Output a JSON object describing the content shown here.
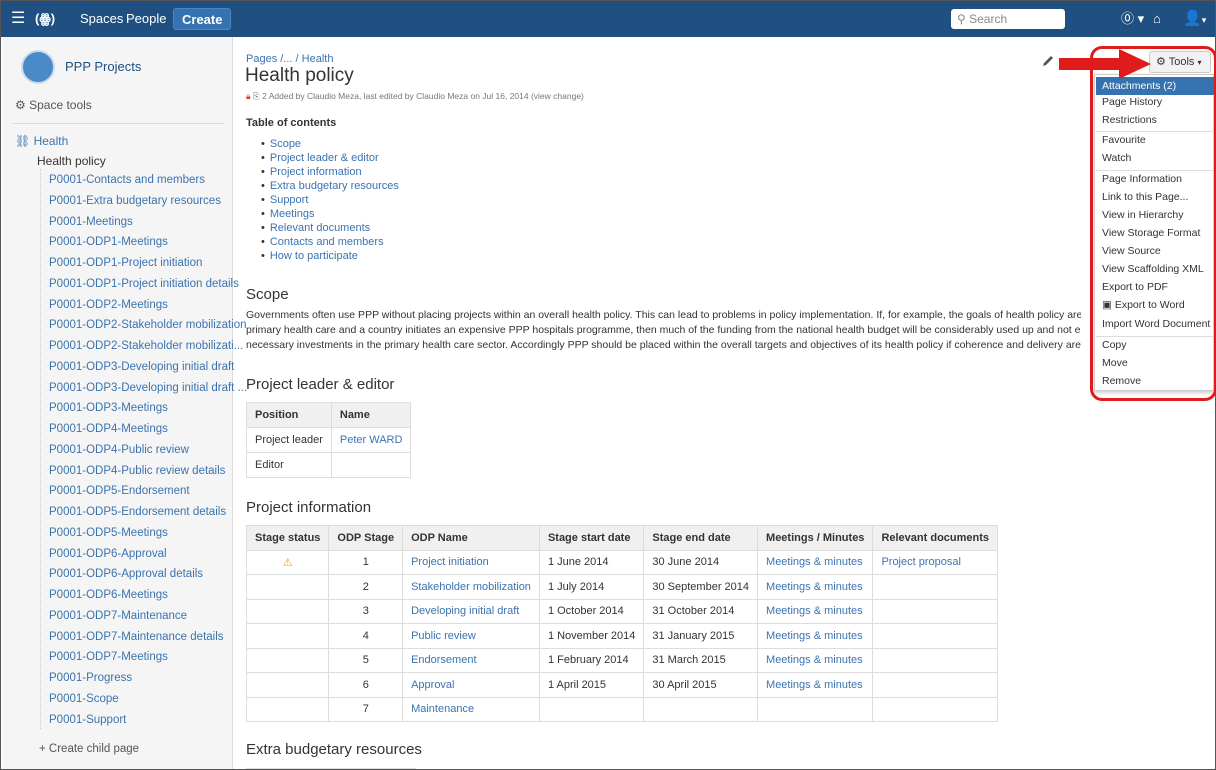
{
  "topbar": {
    "spaces": "Spaces",
    "people": "People",
    "create": "Create",
    "search_placeholder": "Search"
  },
  "sidebar": {
    "space_name": "PPP Projects",
    "space_tools": "Space tools",
    "tree_root": "Health",
    "current_page": "Health policy",
    "children": [
      "P0001-Contacts and members",
      "P0001-Extra budgetary resources",
      "P0001-Meetings",
      "P0001-ODP1-Meetings",
      "P0001-ODP1-Project initiation",
      "P0001-ODP1-Project initiation details",
      "P0001-ODP2-Meetings",
      "P0001-ODP2-Stakeholder mobilization",
      "P0001-ODP2-Stakeholder mobilizati...",
      "P0001-ODP3-Developing initial draft",
      "P0001-ODP3-Developing initial draft ...",
      "P0001-ODP3-Meetings",
      "P0001-ODP4-Meetings",
      "P0001-ODP4-Public review",
      "P0001-ODP4-Public review details",
      "P0001-ODP5-Endorsement",
      "P0001-ODP5-Endorsement details",
      "P0001-ODP5-Meetings",
      "P0001-ODP6-Approval",
      "P0001-ODP6-Approval details",
      "P0001-ODP6-Meetings",
      "P0001-ODP7-Maintenance",
      "P0001-ODP7-Maintenance details",
      "P0001-ODP7-Meetings",
      "P0001-Progress",
      "P0001-Scope",
      "P0001-Support"
    ],
    "create_child": "+ Create child page"
  },
  "page": {
    "breadcrumb": "Pages /... / Health",
    "title": "Health policy",
    "meta": "2 Added by Claudio Meza, last edited by Claudio Meza on Jul 16, 2014  (view change)",
    "toc_heading": "Table of contents",
    "toc": [
      "Scope",
      "Project leader & editor",
      "Project information",
      "Extra budgetary resources",
      "Support",
      "Meetings",
      "Relevant documents",
      "Contacts and members",
      "How to participate"
    ],
    "scope_heading": "Scope",
    "scope_lines": [
      "Governments often use PPP without placing projects within an overall health policy. This can lead to problems in policy implementation. If, for example, the goals of health policy are to impro",
      "primary health care and a country initiates an expensive PPP hospitals programme, then much of the funding from the national health budget will be considerably used up and not enough w",
      "necessary investments in the primary health care sector. Accordingly PPP should be placed within the overall targets and objectives of its health policy if coherence and delivery are to be a"
    ],
    "leader_heading": "Project leader & editor",
    "leader_table": {
      "headers": [
        "Position",
        "Name"
      ],
      "rows": [
        [
          "Project leader",
          "Peter WARD"
        ],
        [
          "Editor",
          ""
        ]
      ]
    },
    "info_heading": "Project information",
    "info_table": {
      "headers": [
        "Stage status",
        "ODP Stage",
        "ODP Name",
        "Stage start date",
        "Stage end date",
        "Meetings / Minutes",
        "Relevant documents"
      ],
      "rows": [
        [
          "⚠",
          "1",
          "Project initiation",
          "1 June 2014",
          "30 June 2014",
          "Meetings & minutes",
          "Project proposal"
        ],
        [
          "",
          "2",
          "Stakeholder mobilization",
          "1 July 2014",
          "30 September 2014",
          "Meetings & minutes",
          ""
        ],
        [
          "",
          "3",
          "Developing initial draft",
          "1 October 2014",
          "31 October 2014",
          "Meetings & minutes",
          ""
        ],
        [
          "",
          "4",
          "Public review",
          "1 November 2014",
          "31 January 2015",
          "Meetings & minutes",
          ""
        ],
        [
          "",
          "5",
          "Endorsement",
          "1 February 2014",
          "31 March 2015",
          "Meetings & minutes",
          ""
        ],
        [
          "",
          "6",
          "Approval",
          "1 April 2015",
          "30 April 2015",
          "Meetings & minutes",
          ""
        ],
        [
          "",
          "7",
          "Maintenance",
          "",
          "",
          "",
          ""
        ]
      ]
    },
    "ebr_heading": "Extra budgetary resources"
  },
  "tools": {
    "button_label": "Tools",
    "menu": [
      "Attachments (2)",
      "Page History",
      "Restrictions",
      "Favourite",
      "Watch",
      "Page Information",
      "Link to this Page...",
      "View in Hierarchy",
      "View Storage Format",
      "View Source",
      "View Scaffolding XML",
      "Export to PDF",
      "Export to Word",
      "Import Word Document",
      "Copy",
      "Move",
      "Remove"
    ]
  },
  "colors": {
    "header": "#205081",
    "link": "#3b73af",
    "highlight": "#3572b0",
    "annotation": "#e01b1b"
  }
}
